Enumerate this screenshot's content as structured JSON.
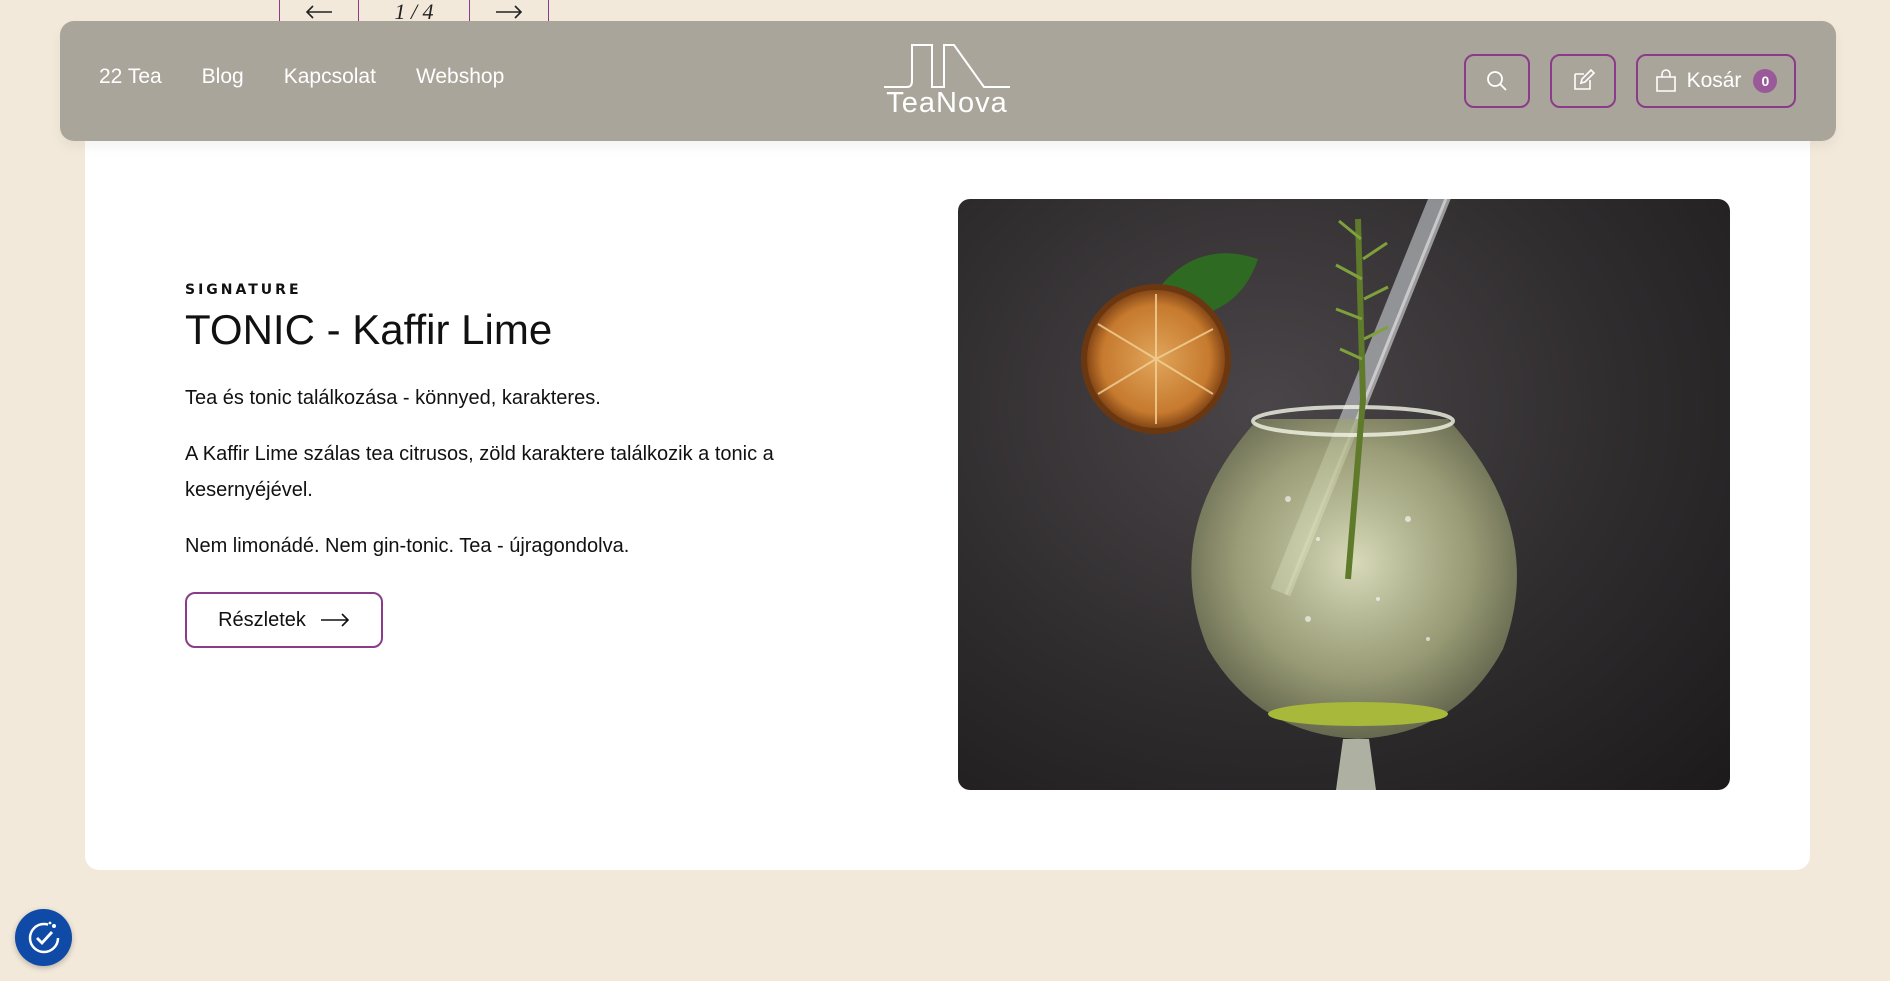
{
  "slider": {
    "prev_label": "←",
    "counter": "1 / 4",
    "next_label": "→"
  },
  "nav": {
    "items": [
      {
        "label": "22 Tea"
      },
      {
        "label": "Blog"
      },
      {
        "label": "Kapcsolat"
      },
      {
        "label": "Webshop"
      }
    ]
  },
  "logo": {
    "text": "TeaNova"
  },
  "actions": {
    "search_icon": "search-icon",
    "edit_icon": "edit-icon",
    "cart_label": "Kosár",
    "cart_count": "0"
  },
  "product": {
    "eyebrow": "SIGNATURE",
    "title": "TONIC - Kaffir Lime",
    "paragraphs": [
      "Tea és tonic találkozása - könnyed, karakteres.",
      "A Kaffir Lime szálas tea citrusos, zöld karaktere találkozik a tonic a kesernyéjével.",
      "Nem limonádé. Nem gin-tonic. Tea - újragondolva."
    ],
    "button_label": "Részletek"
  },
  "colors": {
    "background": "#f3e9da",
    "header": "#aaa59a",
    "accent": "#8a3c8a",
    "badge": "#9a5a9a",
    "cookie": "#0f4aa6"
  }
}
